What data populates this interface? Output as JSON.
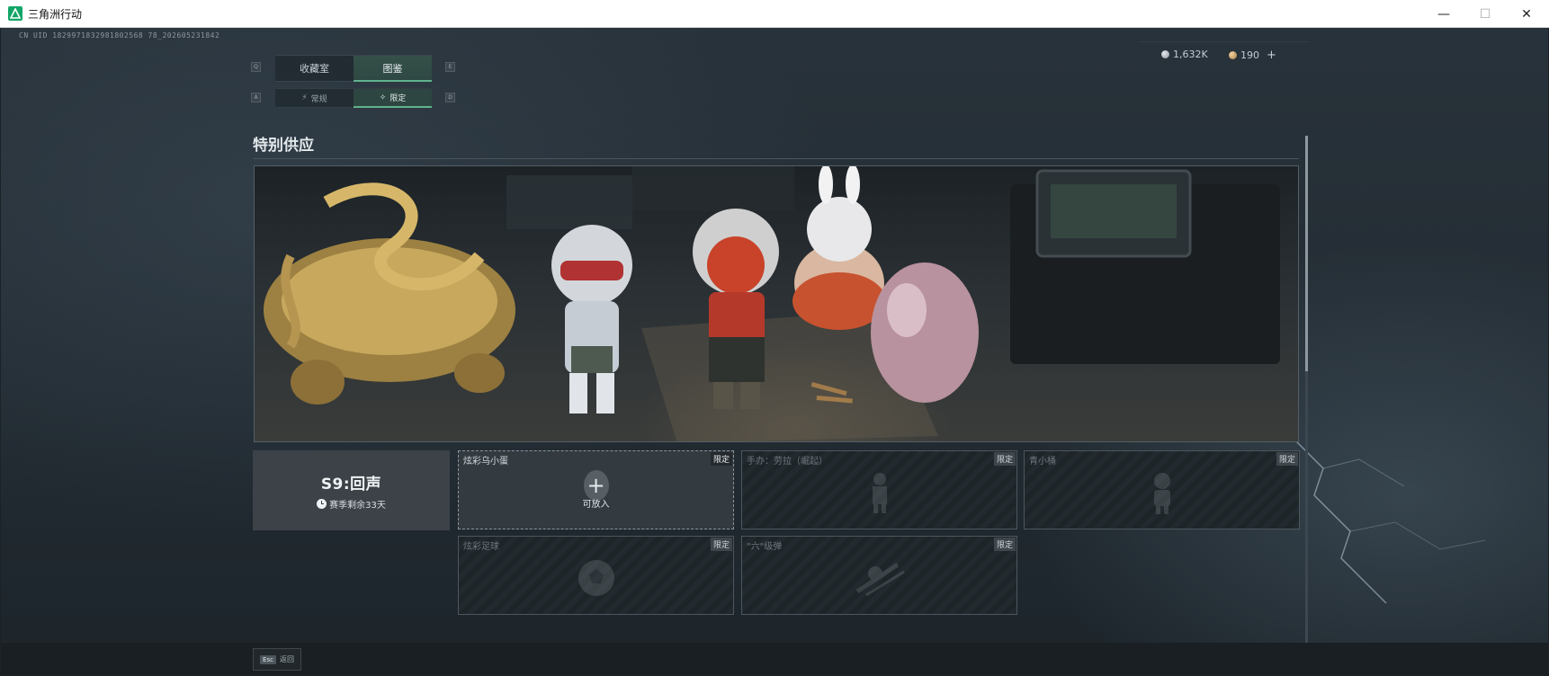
{
  "window": {
    "title": "三角洲行动",
    "minimize_glyph": "—",
    "maximize_glyph": "☐",
    "close_glyph": "✕",
    "icon": "delta-logo-icon"
  },
  "uid_text": "CN UID 1829971832981802568 78_202605231842",
  "currency": [
    {
      "icon": "silver-coin-icon",
      "value": "1,632K"
    },
    {
      "icon": "gold-coin-icon",
      "value": "190",
      "plus": "+"
    }
  ],
  "tabs": {
    "left_key": "Q",
    "right_key": "E",
    "items": [
      {
        "label": "收藏室",
        "active": false
      },
      {
        "label": "图鉴",
        "active": true
      }
    ]
  },
  "subtabs": {
    "left_key": "A",
    "right_key": "D",
    "items": [
      {
        "label": "常规",
        "icon": "lightning-icon",
        "active": false
      },
      {
        "label": "限定",
        "icon": "gift-icon",
        "active": true
      }
    ]
  },
  "section": {
    "title": "特别供应"
  },
  "season": {
    "title": "S9:回声",
    "remaining": "赛季剩余33天"
  },
  "slots": [
    {
      "name": "炫彩乌小蛋",
      "tag": "限定",
      "active": true,
      "plus": "+",
      "action": "可放入"
    },
    {
      "name": "手办：劳拉（崛起）",
      "tag": "限定",
      "active": false
    },
    {
      "name": "青小桶",
      "tag": "限定",
      "active": false
    },
    {
      "name": "炫彩足球",
      "tag": "限定",
      "active": false
    },
    {
      "name": "\"六\"级弹",
      "tag": "限定",
      "active": false
    }
  ],
  "footer": {
    "esc_key": "Esc",
    "esc_label": "返回"
  },
  "colors": {
    "accent": "#5fb38e",
    "background": "#1b2228"
  }
}
